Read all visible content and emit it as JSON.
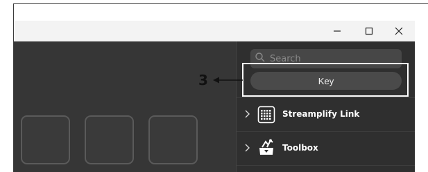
{
  "window": {
    "controls": {
      "minimize_icon": "minimize-icon",
      "maximize_icon": "maximize-icon",
      "close_icon": "close-icon"
    }
  },
  "panel": {
    "search": {
      "placeholder": "Search",
      "icon": "search-icon"
    },
    "key_button_label": "Key",
    "categories": [
      {
        "label": "Streamplify Link",
        "icon": "keyboard-grid-icon"
      },
      {
        "label": "Toolbox",
        "icon": "toolbox-icon"
      }
    ]
  },
  "callout": {
    "number": "3"
  },
  "colors": {
    "window_bg": "#353535",
    "panel_bg": "#2f2f2f",
    "titlebar_bg": "#f3f3f3",
    "highlight": "#ffffff",
    "callout_text": "#111111"
  }
}
